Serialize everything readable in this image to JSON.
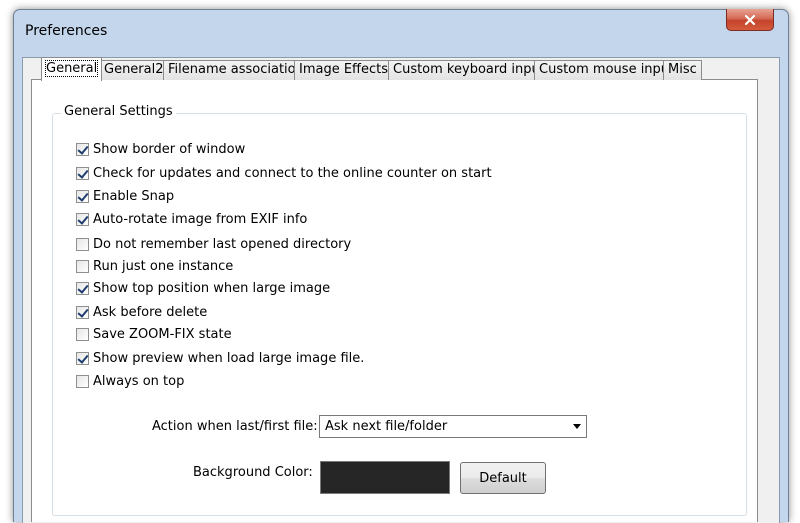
{
  "window": {
    "title": "Preferences"
  },
  "tabs": [
    {
      "label": "General",
      "active": true
    },
    {
      "label": "General2"
    },
    {
      "label": "Filename association"
    },
    {
      "label": "Image Effects"
    },
    {
      "label": "Custom keyboard input"
    },
    {
      "label": "Custom mouse input"
    },
    {
      "label": "Misc"
    }
  ],
  "group": {
    "legend": "General Settings"
  },
  "options": [
    {
      "label": "Show border of window",
      "checked": true
    },
    {
      "label": "Check for updates and connect to the online counter on start",
      "checked": true
    },
    {
      "label": "Enable Snap",
      "checked": true
    },
    {
      "label": "Auto-rotate image from EXIF info",
      "checked": true
    },
    {
      "label": "Do not remember last opened directory",
      "checked": false
    },
    {
      "label": "Run just one instance",
      "checked": false
    },
    {
      "label": "Show top position when large image",
      "checked": true
    },
    {
      "label": "Ask before delete",
      "checked": true
    },
    {
      "label": "Save ZOOM-FIX state",
      "checked": false
    },
    {
      "label": "Show preview when load large image file.",
      "checked": true
    },
    {
      "label": "Always on top",
      "checked": false
    }
  ],
  "action": {
    "label": "Action when last/first file:",
    "selected": "Ask next file/folder"
  },
  "background": {
    "label": "Background Color:",
    "color": "#262626",
    "default_label": "Default"
  },
  "icons": {
    "close": "close-icon",
    "dropdown": "chevron-down-icon"
  }
}
